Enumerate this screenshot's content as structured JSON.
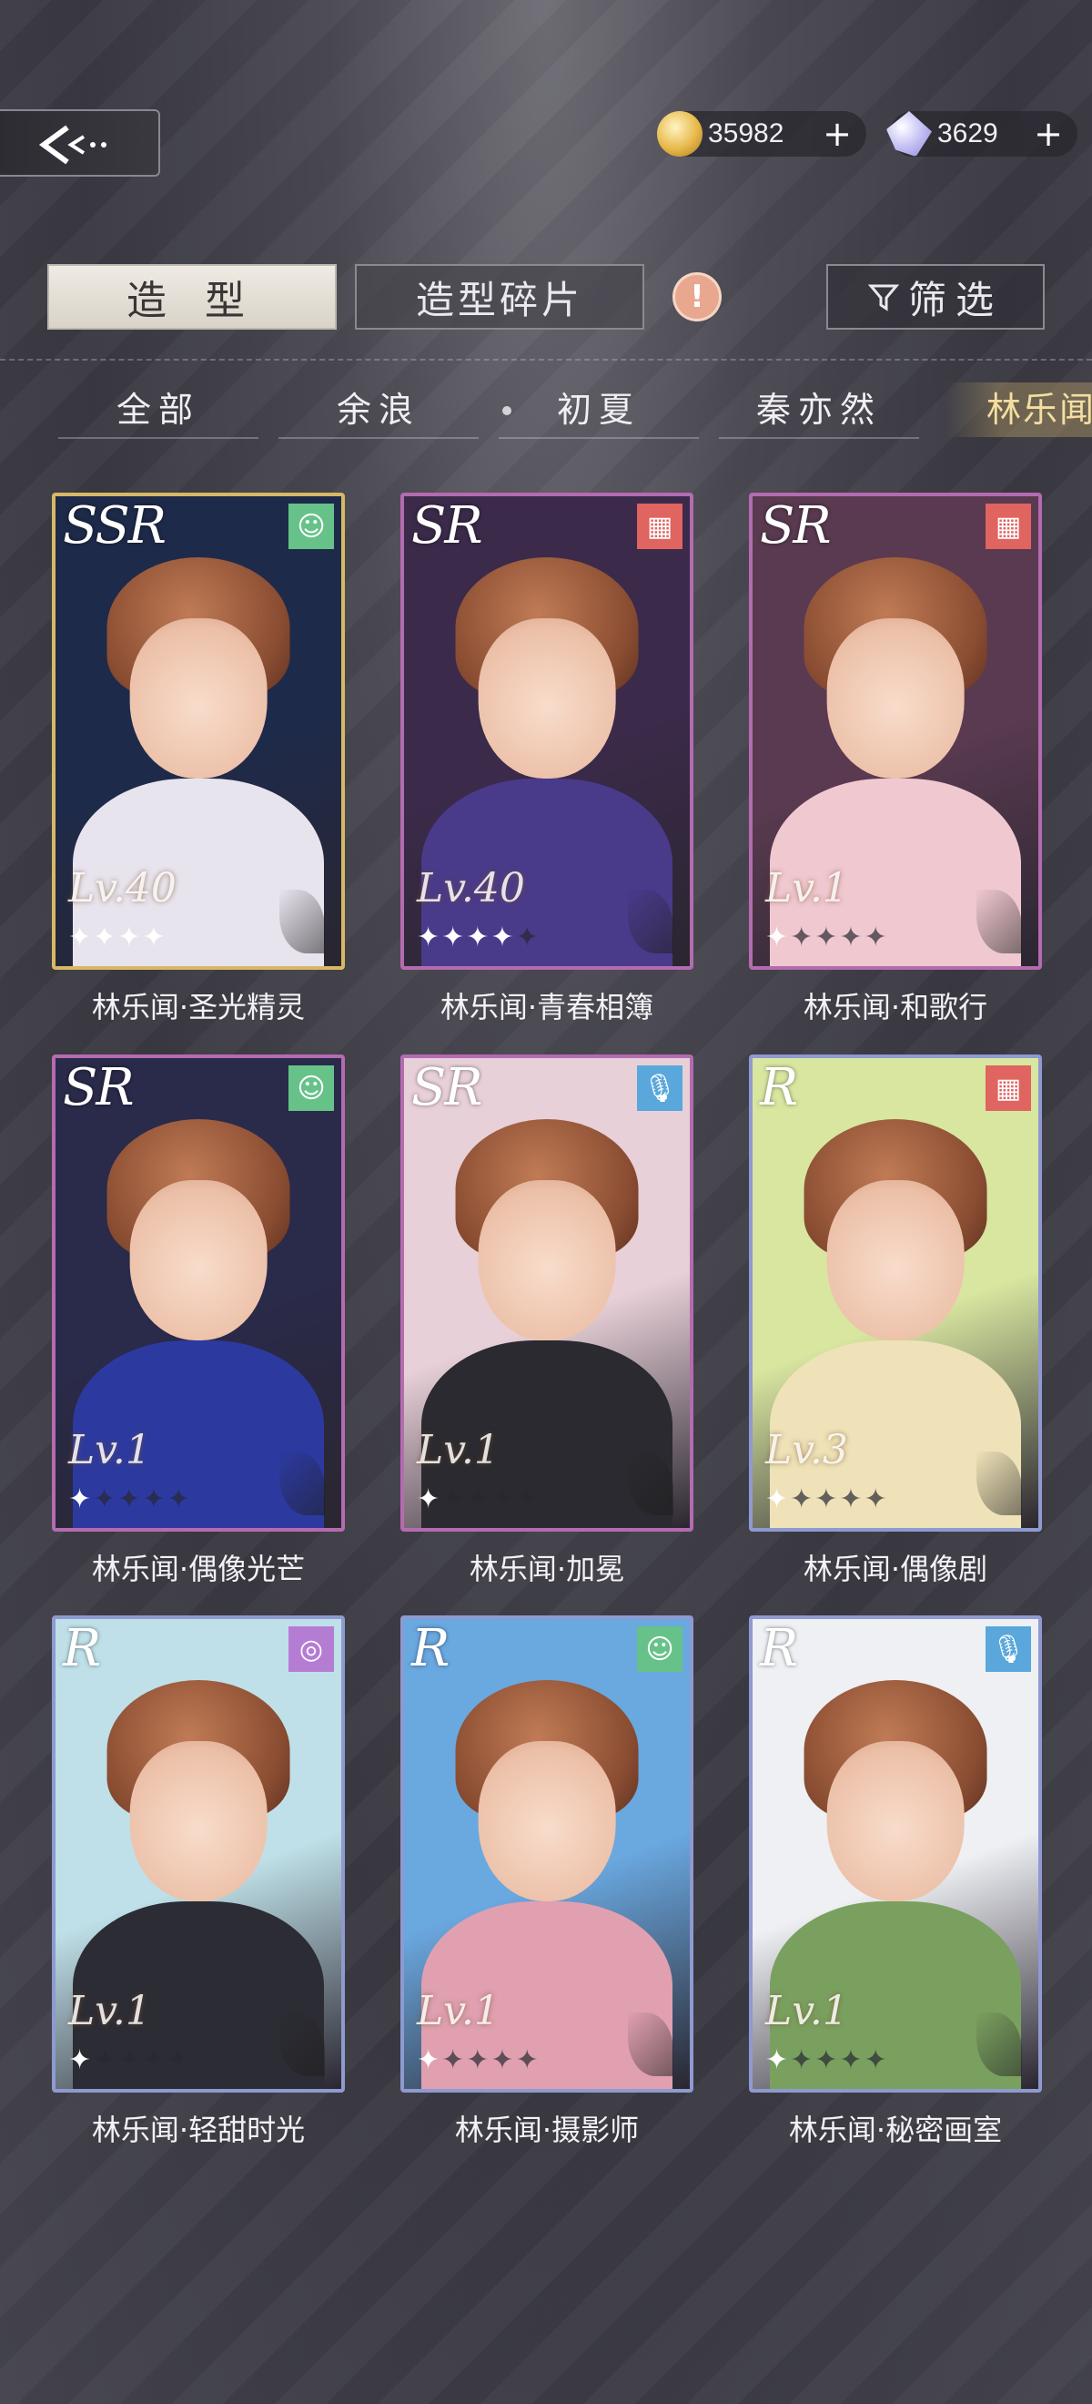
{
  "header": {
    "back_icon": "back-arrow-icon",
    "coins": {
      "icon": "coin-icon",
      "value": "35982",
      "add": "+"
    },
    "gems": {
      "icon": "gem-icon",
      "value": "3629",
      "add": "+"
    }
  },
  "tabs": {
    "styles": "造 型",
    "fragments": "造型碎片",
    "warning": "!",
    "filter": "筛选",
    "filter_icon": "filter-icon"
  },
  "characters": [
    "全部",
    "余浪",
    "初夏",
    "秦亦然",
    "林乐闻"
  ],
  "selected_character": "林乐闻",
  "cards": [
    {
      "rarity": "SSR",
      "badge": "smile-icon",
      "level": "Lv.40",
      "stars": 4,
      "max_stars": 4,
      "name": "林乐闻·圣光精灵"
    },
    {
      "rarity": "SR",
      "badge": "clapperboard-icon",
      "level": "Lv.40",
      "stars": 4,
      "max_stars": 5,
      "name": "林乐闻·青春相簿"
    },
    {
      "rarity": "SR",
      "badge": "clapperboard-icon",
      "level": "Lv.1",
      "stars": 1,
      "max_stars": 5,
      "name": "林乐闻·和歌行"
    },
    {
      "rarity": "SR",
      "badge": "smile-icon",
      "level": "Lv.1",
      "stars": 1,
      "max_stars": 5,
      "name": "林乐闻·偶像光芒"
    },
    {
      "rarity": "SR",
      "badge": "microphone-icon",
      "level": "Lv.1",
      "stars": 1,
      "max_stars": 5,
      "name": "林乐闻·加冕"
    },
    {
      "rarity": "R",
      "badge": "clapperboard-icon",
      "level": "Lv.3",
      "stars": 1,
      "max_stars": 5,
      "name": "林乐闻·偶像剧"
    },
    {
      "rarity": "R",
      "badge": "ring-icon",
      "level": "Lv.1",
      "stars": 1,
      "max_stars": 5,
      "name": "林乐闻·轻甜时光"
    },
    {
      "rarity": "R",
      "badge": "smile-icon",
      "level": "Lv.1",
      "stars": 1,
      "max_stars": 5,
      "name": "林乐闻·摄影师"
    },
    {
      "rarity": "R",
      "badge": "microphone-icon",
      "level": "Lv.1",
      "stars": 1,
      "max_stars": 5,
      "name": "林乐闻·秘密画室"
    }
  ]
}
